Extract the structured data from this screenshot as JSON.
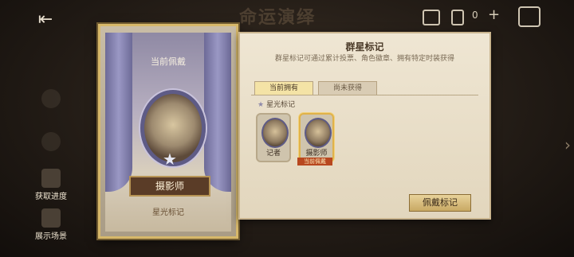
{
  "bg_title": "命运演绎",
  "left_menu": [
    {
      "label": "",
      "name": "menu-item-1",
      "dim": true
    },
    {
      "label": "",
      "name": "menu-item-2",
      "dim": true
    },
    {
      "label": "获取进度",
      "name": "menu-item-progress"
    },
    {
      "label": "展示场景",
      "name": "menu-item-scene"
    }
  ],
  "top_counter": "0",
  "card": {
    "top_label": "当前佩戴",
    "character_name": "摄影师",
    "bottom_label": "星光标记"
  },
  "panel": {
    "title": "群星标记",
    "description": "群星标记可通过累计投票、角色徽章、拥有特定时装获得",
    "tabs": [
      {
        "label": "当前拥有",
        "active": true
      },
      {
        "label": "尚未获得",
        "active": false
      }
    ],
    "section_label": "星光标记",
    "items": [
      {
        "name": "记者"
      },
      {
        "name": "摄影师"
      }
    ],
    "current_badge": "当前佩戴",
    "wear_button": "佩戴标记"
  }
}
